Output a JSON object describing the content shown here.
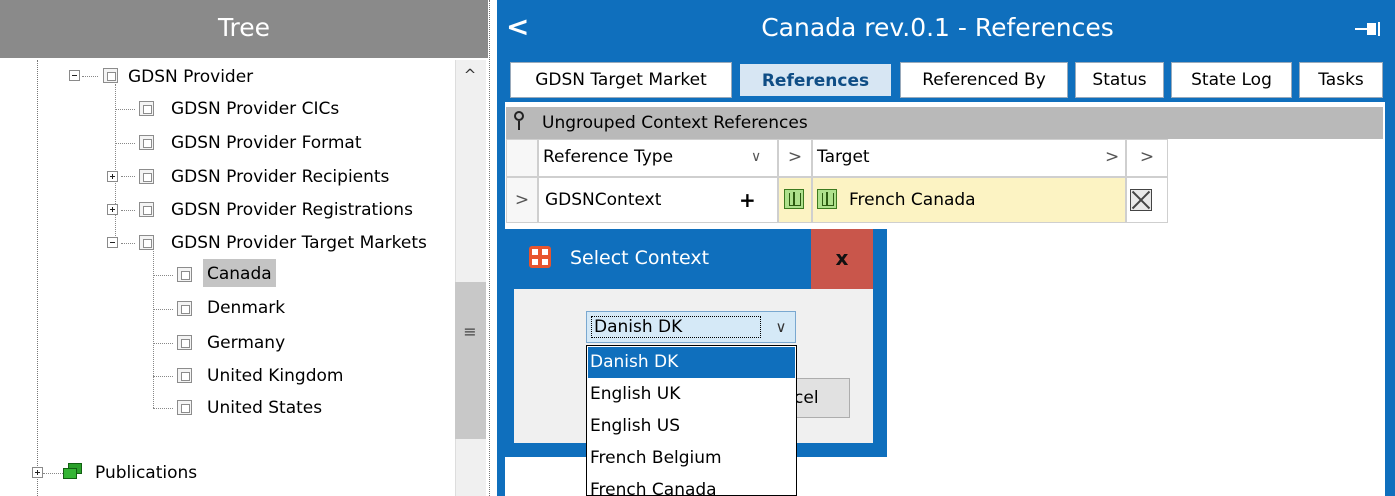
{
  "tree": {
    "header": "Tree",
    "nodes": [
      {
        "label": "GDSN Provider",
        "expander": "minus"
      },
      {
        "label": "GDSN Provider CICs",
        "expander": ""
      },
      {
        "label": "GDSN Provider Format",
        "expander": ""
      },
      {
        "label": "GDSN Provider Recipients",
        "expander": "plus"
      },
      {
        "label": "GDSN Provider Registrations",
        "expander": "plus"
      },
      {
        "label": "GDSN Provider Target Markets",
        "expander": "minus"
      },
      {
        "label": "Canada",
        "expander": "",
        "selected": true
      },
      {
        "label": "Denmark",
        "expander": ""
      },
      {
        "label": "Germany",
        "expander": ""
      },
      {
        "label": "United Kingdom",
        "expander": ""
      },
      {
        "label": "United States",
        "expander": ""
      },
      {
        "label": "Publications",
        "expander": "plus"
      }
    ],
    "scroll_up_glyph": "^",
    "scroll_grip_glyph": "≡"
  },
  "window": {
    "title": "Canada rev.0.1 - References",
    "back_glyph": "<",
    "tabs": [
      {
        "label": "GDSN Target Market",
        "active": false
      },
      {
        "label": "References",
        "active": true
      },
      {
        "label": "Referenced By",
        "active": false
      },
      {
        "label": "Status",
        "active": false
      },
      {
        "label": "State Log",
        "active": false
      },
      {
        "label": "Tasks",
        "active": false
      }
    ]
  },
  "references": {
    "group_label": "Ungrouped Context References",
    "columns": {
      "reference_type": "Reference Type",
      "reference_type_sort": "∨",
      "expand": ">",
      "target": "Target",
      "target_expand": ">",
      "last_expand": ">"
    },
    "row": {
      "expand": ">",
      "reference_type": "GDSNContext",
      "add": "+",
      "target": "French Canada"
    }
  },
  "dialog": {
    "title": "Select Context",
    "close_label": "x",
    "combo_value": "Danish DK",
    "combo_arrow": "∨",
    "cancel_partial": "Cancel",
    "options": [
      "Danish DK",
      "English UK",
      "English US",
      "French Belgium",
      "French Canada"
    ],
    "selected_option": "Danish DK"
  },
  "colors": {
    "accent": "#0f6fbd",
    "tree_header": "#8a8a8a",
    "close_button": "#c9564b",
    "target_cell": "#fcf3c3",
    "icon_green": "#aee08c"
  }
}
